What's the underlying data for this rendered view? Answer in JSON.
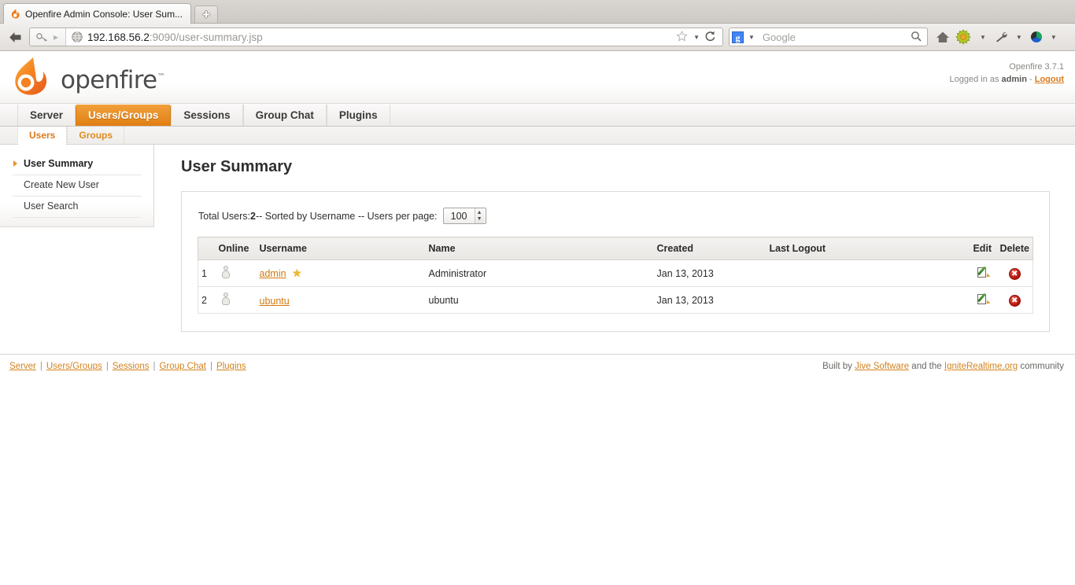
{
  "browser": {
    "tab_title": "Openfire Admin Console: User Sum...",
    "newtab_label": "+",
    "back_icon": "back-arrow-icon",
    "url_prefix": "192.168.56.2",
    "url_suffix": ":9090/user-summary.jsp",
    "identity_icon": "key-icon",
    "globe_icon": "globe-icon",
    "star_icon": "★",
    "dropdown_caret": "▼",
    "reload_icon": "↻",
    "search_engine": "g-logo-icon",
    "search_placeholder": "Google",
    "magnifier_icon": "search-icon",
    "home_icon": "⌂",
    "gear_icon": "gear-icon",
    "wrench_icon": "wrench-icon",
    "color_icon": "color-wheel-icon"
  },
  "header": {
    "logo_alt": "openfire-flame-logo",
    "wordmark": "openfire",
    "trademark": "™",
    "version": "Openfire 3.7.1",
    "logged_in_prefix": "Logged in as ",
    "logged_in_user": "admin",
    "logged_in_dash": " - ",
    "logout_label": "Logout"
  },
  "main_tabs": [
    {
      "label": "Server",
      "active": false
    },
    {
      "label": "Users/Groups",
      "active": true
    },
    {
      "label": "Sessions",
      "active": false
    },
    {
      "label": "Group Chat",
      "active": false
    },
    {
      "label": "Plugins",
      "active": false
    }
  ],
  "sub_tabs": [
    {
      "label": "Users",
      "active": true
    },
    {
      "label": "Groups",
      "active": false
    }
  ],
  "sidebar": {
    "items": [
      {
        "label": "User Summary",
        "active": true
      },
      {
        "label": "Create New User",
        "active": false
      },
      {
        "label": "User Search",
        "active": false
      }
    ]
  },
  "main": {
    "page_title": "User Summary",
    "summary_prefix": "Total Users: ",
    "total_users": "2",
    "summary_middle": " -- Sorted by Username -- Users per page: ",
    "users_per_page": "100",
    "spinner_up": "▲",
    "spinner_down": "▼",
    "table": {
      "columns": [
        "",
        "Online",
        "Username",
        "Name",
        "Created",
        "Last Logout",
        "Edit",
        "Delete"
      ],
      "rows": [
        {
          "index": "1",
          "online_icon": "user-offline-icon",
          "username": "admin",
          "badge_icon": "★",
          "name": "Administrator",
          "created": "Jan 13, 2013",
          "last_logout": "",
          "edit_icon": "edit-pencil-icon",
          "delete_icon": "✖"
        },
        {
          "index": "2",
          "online_icon": "user-offline-icon",
          "username": "ubuntu",
          "badge_icon": "",
          "name": "ubuntu",
          "created": "Jan 13, 2013",
          "last_logout": "",
          "edit_icon": "edit-pencil-icon",
          "delete_icon": "✖"
        }
      ]
    }
  },
  "footer": {
    "links": [
      "Server",
      "Users/Groups",
      "Sessions",
      "Group Chat",
      "Plugins"
    ],
    "separator": "|",
    "built_by_prefix": "Built by ",
    "jive_label": "Jive Software",
    "built_by_middle": " and the ",
    "ignite_label": "IgniteRealtime.org",
    "built_by_suffix": " community"
  },
  "colors": {
    "accent_orange": "#e07f12",
    "link_orange": "#d2790f",
    "delete_red": "#b31108"
  }
}
